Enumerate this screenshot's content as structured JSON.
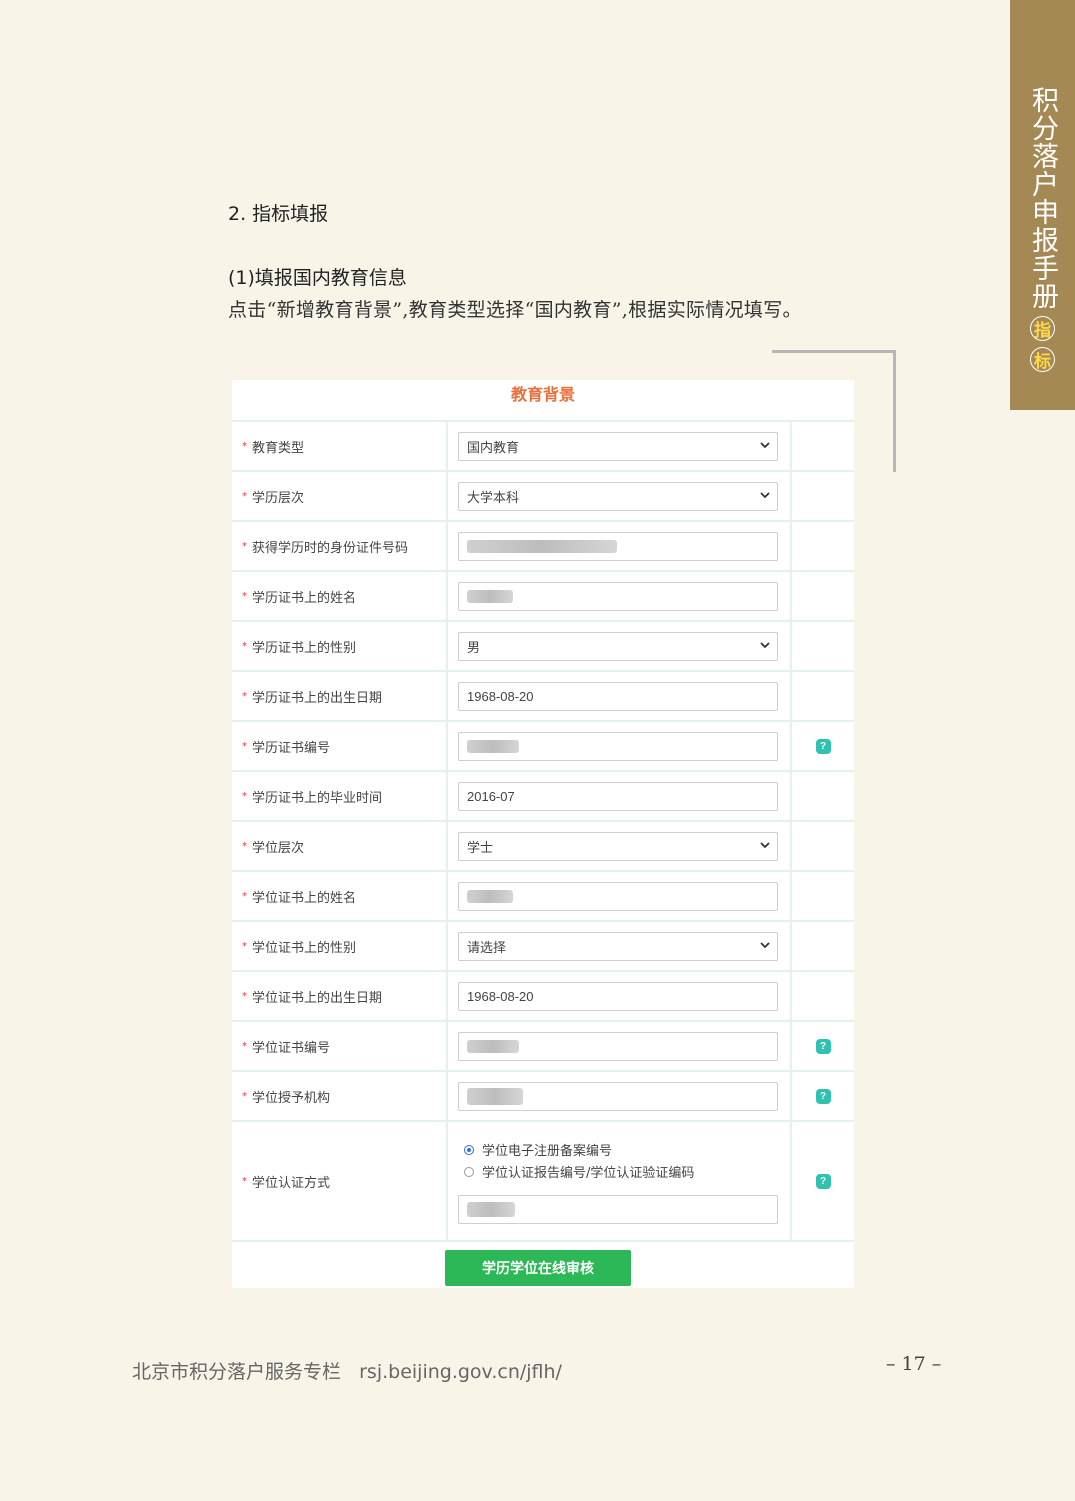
{
  "side_tab": {
    "title": "积分落户申报手册",
    "badge_1": "指",
    "badge_2": "标"
  },
  "section_heading": "2. 指标填报",
  "subsection_heading": "(1)填报国内教育信息",
  "description": "点击“新增教育背景”,教育类型选择“国内教育”,根据实际情况填写。",
  "form": {
    "title": "教育背景",
    "required_mark": "*",
    "rows": [
      {
        "label": "教育类型",
        "type": "select",
        "value": "国内教育"
      },
      {
        "label": "学历层次",
        "type": "select",
        "value": "大学本科"
      },
      {
        "label": "获得学历时的身份证件号码",
        "type": "input",
        "value": ""
      },
      {
        "label": "学历证书上的姓名",
        "type": "input",
        "value": ""
      },
      {
        "label": "学历证书上的性别",
        "type": "select",
        "value": "男"
      },
      {
        "label": "学历证书上的出生日期",
        "type": "input",
        "value": "1968-08-20"
      },
      {
        "label": "学历证书编号",
        "type": "input",
        "value": ""
      },
      {
        "label": "学历证书上的毕业时间",
        "type": "input",
        "value": "2016-07"
      },
      {
        "label": "学位层次",
        "type": "select",
        "value": "学士"
      },
      {
        "label": "学位证书上的姓名",
        "type": "input",
        "value": ""
      },
      {
        "label": "学位证书上的性别",
        "type": "select",
        "value": "请选择"
      },
      {
        "label": "学位证书上的出生日期",
        "type": "input",
        "value": "1968-08-20"
      },
      {
        "label": "学位证书编号",
        "type": "input",
        "value": ""
      },
      {
        "label": "学位授予机构",
        "type": "input",
        "value": ""
      }
    ],
    "cert_method": {
      "label": "学位认证方式",
      "option_1": "学位电子注册备案编号",
      "option_2": "学位认证报告编号/学位认证验证编码",
      "value": ""
    },
    "help_icon": "?",
    "submit_label": "学历学位在线审核"
  },
  "footer": {
    "text": "北京市积分落户服务专栏   rsj.beijing.gov.cn/jflh/",
    "page_number": "– 17 –"
  }
}
